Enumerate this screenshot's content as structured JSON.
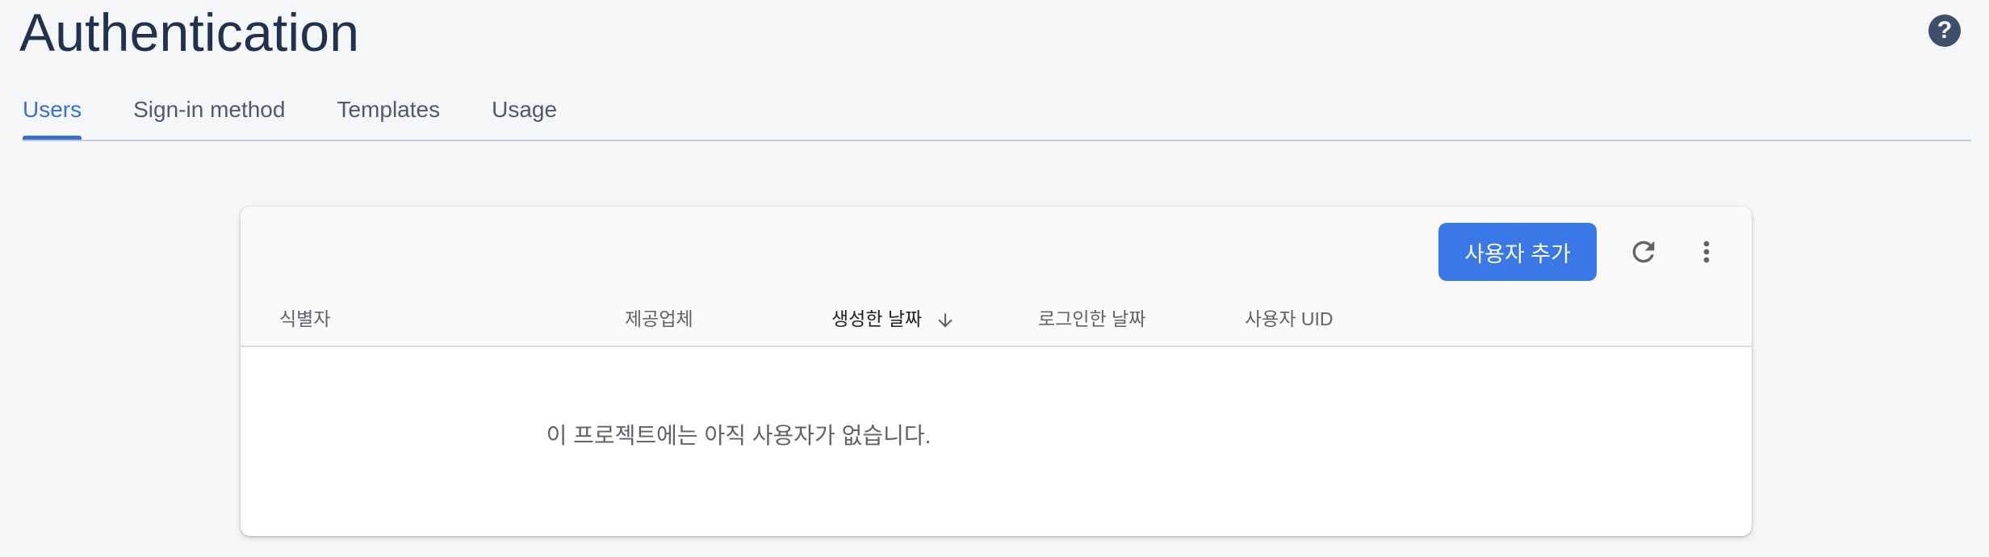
{
  "header": {
    "title": "Authentication",
    "help_icon": "help-circle-icon",
    "help_glyph": "?"
  },
  "tabs": [
    {
      "label": "Users",
      "active": true
    },
    {
      "label": "Sign-in method",
      "active": false
    },
    {
      "label": "Templates",
      "active": false
    },
    {
      "label": "Usage",
      "active": false
    }
  ],
  "users_table": {
    "add_user_label": "사용자 추가",
    "refresh_icon": "refresh-icon",
    "more_icon": "more-vert-icon",
    "columns": [
      {
        "label": "식별자",
        "sorted": false
      },
      {
        "label": "제공업체",
        "sorted": false
      },
      {
        "label": "생성한 날짜",
        "sorted": true,
        "sort_direction": "descending"
      },
      {
        "label": "로그인한 날짜",
        "sorted": false
      },
      {
        "label": "사용자 UID",
        "sorted": false
      }
    ],
    "rows": [],
    "empty_message": "이 프로젝트에는 아직 사용자가 없습니다."
  },
  "colors": {
    "accent": "#3b6ecf",
    "primary_button": "#3a78e7",
    "title": "#22314d",
    "background": "#f5f6f8"
  }
}
